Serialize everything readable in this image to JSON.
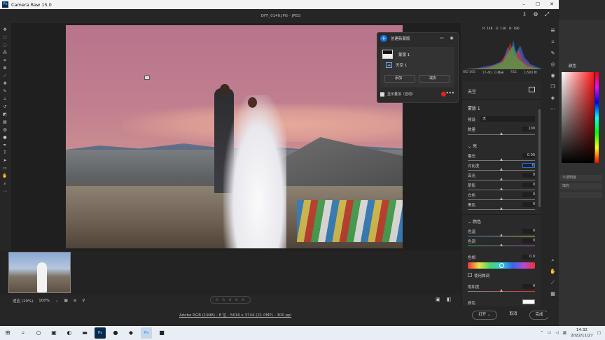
{
  "app": {
    "title": "Camera Raw 15.0",
    "ps_icon": "Ps"
  },
  "document": {
    "filename": "DFF_0140.JPG -  JPEG"
  },
  "window_buttons": {
    "minimize": "–",
    "maximize": "☐",
    "close": "✕"
  },
  "masks": {
    "create_label": "创建新蒙版",
    "mask_name": "蒙版 1",
    "component_name": "天空 1",
    "add_label": "添加",
    "subtract_label": "减去",
    "overlay_label": "显示叠加（自动）",
    "overlay_color": "#e0231c"
  },
  "histogram": {
    "values": [
      "R: 148",
      "G: 136",
      "B: 186"
    ]
  },
  "camera_info": [
    "ISO 100",
    "17-40...0 毫米",
    "f/11",
    "1/500 秒"
  ],
  "panel": {
    "title": "天空",
    "mask_title": "蒙版 1",
    "preset_label": "预设",
    "preset_value": "无",
    "amount_label": "数量",
    "amount_value": "100",
    "light_section": "亮",
    "sliders_light": [
      {
        "label": "曝光",
        "value": "0.00"
      },
      {
        "label": "对比度",
        "value": "0"
      },
      {
        "label": "高光",
        "value": "0"
      },
      {
        "label": "阴影",
        "value": "0"
      },
      {
        "label": "白色",
        "value": "0"
      },
      {
        "label": "黑色",
        "value": "0"
      }
    ],
    "color_section": "颜色",
    "sliders_color": [
      {
        "label": "色温",
        "value": "0"
      },
      {
        "label": "色调",
        "value": "0"
      }
    ],
    "hue_label": "色相",
    "hue_value": "0.0",
    "fine_adjust_label": "使用微调",
    "saturation_label": "饱和度",
    "saturation_value": "0",
    "color_label": "颜色"
  },
  "bottom": {
    "fit_label": "适应 (19%)",
    "zoom_label": "100%",
    "stars": "☆ ☆ ☆ ☆ ☆"
  },
  "footer": {
    "info": "Adobe RGB (1998) - 8 位 - 5616 x 3744 (21.0MP) - 300 ppi",
    "open_label": "打开",
    "cancel_label": "取消",
    "done_label": "完成"
  },
  "ps_background": {
    "panel_tab": "颜色",
    "layer_label": "不透明度",
    "fill_label": "填充"
  },
  "taskbar": {
    "time": "14:32",
    "date": "2022/11/27",
    "lang": "英"
  }
}
